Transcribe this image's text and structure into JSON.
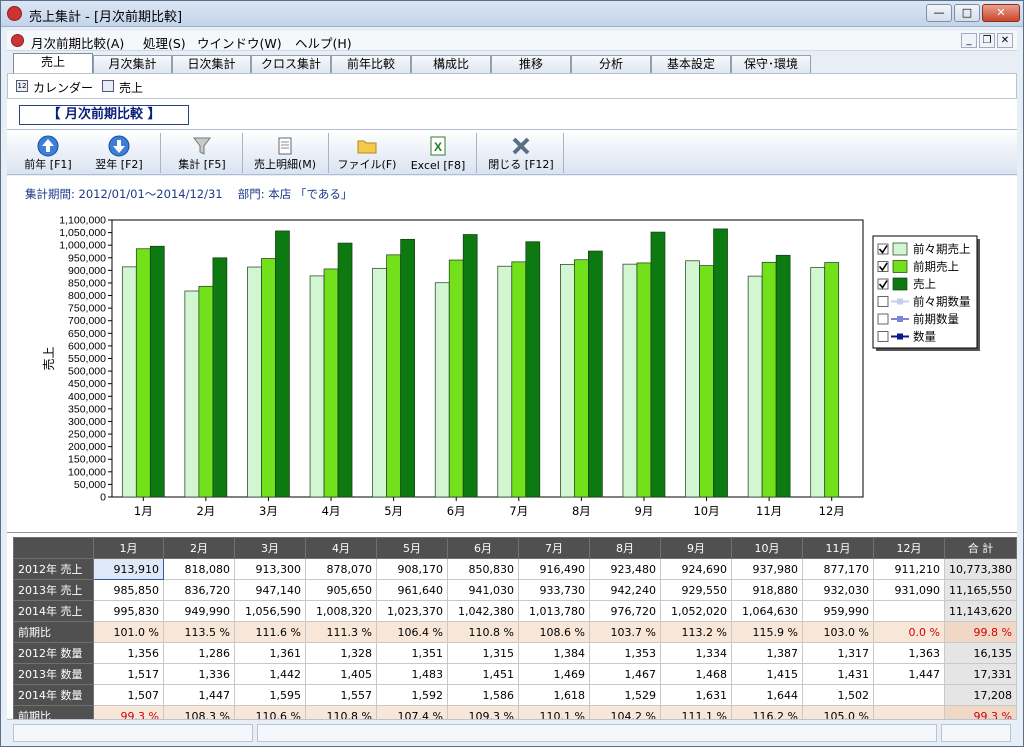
{
  "window": {
    "title": "売上集計 - [月次前期比較]"
  },
  "menu": [
    "月次前期比較(A)",
    "処理(S)",
    "ウインドウ(W)",
    "ヘルプ(H)"
  ],
  "tabs": [
    "売上",
    "月次集計",
    "日次集計",
    "クロス集計",
    "前年比較",
    "構成比",
    "推移",
    "分析",
    "基本設定",
    "保守･環境"
  ],
  "subtools": {
    "calendar": "カレンダー",
    "sales": "売上"
  },
  "page_title": "【 月次前期比較 】",
  "toolbar": [
    "前年 [F1]",
    "翌年 [F2]",
    "集計 [F5]",
    "売上明細(M)",
    "ファイル(F)",
    "Excel [F8]",
    "閉じる [F12]"
  ],
  "info": "集計期間:  2012/01/01～2014/12/31　 部門:  本店 「である」",
  "legend": [
    {
      "label": "前々期売上",
      "checked": true,
      "type": "bar",
      "color": "#d2f5d2"
    },
    {
      "label": "前期売上",
      "checked": true,
      "type": "bar",
      "color": "#72e01a"
    },
    {
      "label": "売上",
      "checked": true,
      "type": "bar",
      "color": "#0c7a10"
    },
    {
      "label": "前々期数量",
      "checked": false,
      "type": "line",
      "color": "#c8ccee"
    },
    {
      "label": "前期数量",
      "checked": false,
      "type": "line",
      "color": "#7a84d8"
    },
    {
      "label": "数量",
      "checked": false,
      "type": "line",
      "color": "#0a1a8a"
    }
  ],
  "chart_data": {
    "type": "bar",
    "ylabel": "売上",
    "xlabel": "",
    "categories": [
      "1月",
      "2月",
      "3月",
      "4月",
      "5月",
      "6月",
      "7月",
      "8月",
      "9月",
      "10月",
      "11月",
      "12月"
    ],
    "ylim": [
      0,
      1100000
    ],
    "ytick_step": 50000,
    "grid": false,
    "legend_position": "right",
    "series": [
      {
        "name": "前々期売上",
        "color": "#d2f5d2",
        "values": [
          913910,
          818080,
          913300,
          878070,
          908170,
          850830,
          916490,
          923480,
          924690,
          937980,
          877170,
          911210
        ]
      },
      {
        "name": "前期売上",
        "color": "#72e01a",
        "values": [
          985850,
          836720,
          947140,
          905650,
          961640,
          941030,
          933730,
          942240,
          929550,
          918880,
          932030,
          931090
        ]
      },
      {
        "name": "売上",
        "color": "#0c7a10",
        "values": [
          995830,
          949990,
          1056590,
          1008320,
          1023370,
          1042380,
          1013780,
          976720,
          1052020,
          1064630,
          959990,
          null
        ]
      }
    ]
  },
  "table": {
    "headers": [
      "",
      "1月",
      "2月",
      "3月",
      "4月",
      "5月",
      "6月",
      "7月",
      "8月",
      "9月",
      "10月",
      "11月",
      "12月",
      "合 計"
    ],
    "rows": [
      {
        "label": "2012年 売上",
        "ratio": false,
        "cells": [
          "913,910",
          "818,080",
          "913,300",
          "878,070",
          "908,170",
          "850,830",
          "916,490",
          "923,480",
          "924,690",
          "937,980",
          "877,170",
          "911,210",
          "10,773,380"
        ]
      },
      {
        "label": "2013年 売上",
        "ratio": false,
        "cells": [
          "985,850",
          "836,720",
          "947,140",
          "905,650",
          "961,640",
          "941,030",
          "933,730",
          "942,240",
          "929,550",
          "918,880",
          "932,030",
          "931,090",
          "11,165,550"
        ]
      },
      {
        "label": "2014年 売上",
        "ratio": false,
        "cells": [
          "995,830",
          "949,990",
          "1,056,590",
          "1,008,320",
          "1,023,370",
          "1,042,380",
          "1,013,780",
          "976,720",
          "1,052,020",
          "1,064,630",
          "959,990",
          "",
          "11,143,620"
        ]
      },
      {
        "label": "前期比",
        "ratio": true,
        "cells": [
          "101.0 %",
          "113.5 %",
          "111.6 %",
          "111.3 %",
          "106.4 %",
          "110.8 %",
          "108.6 %",
          "103.7 %",
          "113.2 %",
          "115.9 %",
          "103.0 %",
          "0.0 %",
          "99.8 %"
        ]
      },
      {
        "label": "2012年 数量",
        "ratio": false,
        "cells": [
          "1,356",
          "1,286",
          "1,361",
          "1,328",
          "1,351",
          "1,315",
          "1,384",
          "1,353",
          "1,334",
          "1,387",
          "1,317",
          "1,363",
          "16,135"
        ]
      },
      {
        "label": "2013年 数量",
        "ratio": false,
        "cells": [
          "1,517",
          "1,336",
          "1,442",
          "1,405",
          "1,483",
          "1,451",
          "1,469",
          "1,467",
          "1,468",
          "1,415",
          "1,431",
          "1,447",
          "17,331"
        ]
      },
      {
        "label": "2014年 数量",
        "ratio": false,
        "cells": [
          "1,507",
          "1,447",
          "1,595",
          "1,557",
          "1,592",
          "1,586",
          "1,618",
          "1,529",
          "1,631",
          "1,644",
          "1,502",
          "",
          "17,208"
        ]
      },
      {
        "label": "前期比",
        "ratio": true,
        "cells": [
          "99.3 %",
          "108.3 %",
          "110.6 %",
          "110.8 %",
          "107.4 %",
          "109.3 %",
          "110.1 %",
          "104.2 %",
          "111.1 %",
          "116.2 %",
          "105.0 %",
          "",
          "99.3 %"
        ]
      }
    ]
  }
}
